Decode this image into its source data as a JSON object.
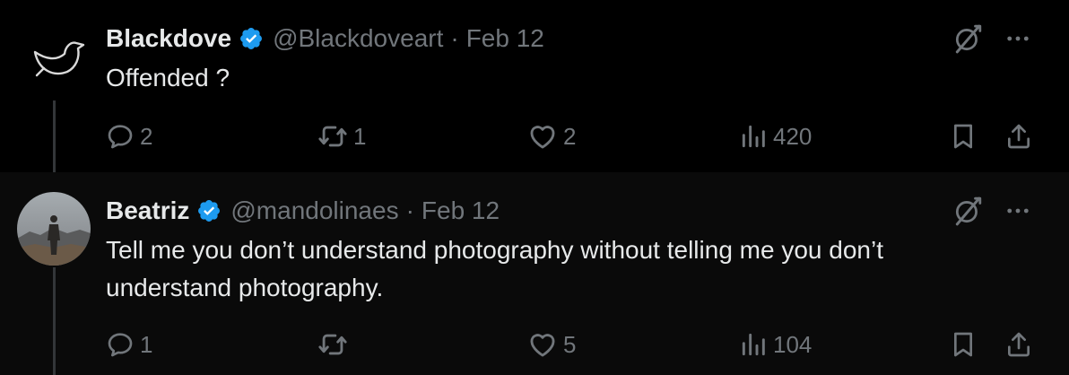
{
  "tweets": [
    {
      "name": "Blackdove",
      "handle": "@Blackdoveart",
      "separator": "·",
      "date": "Feb 12",
      "text": "Offended ?",
      "replies": "2",
      "retweets": "1",
      "likes": "2",
      "views": "420"
    },
    {
      "name": "Beatriz",
      "handle": "@mandolinaes",
      "separator": "·",
      "date": "Feb 12",
      "text": "Tell me you don’t understand photography without telling me you don’t understand photography.",
      "replies": "1",
      "retweets": "",
      "likes": "5",
      "views": "104"
    }
  ],
  "icons": {
    "verified": "verified-badge-icon",
    "grok": "grok-icon",
    "more": "more-icon",
    "reply": "reply-icon",
    "retweet": "retweet-icon",
    "like": "heart-icon",
    "views": "views-icon",
    "bookmark": "bookmark-icon",
    "share": "share-icon"
  },
  "colors": {
    "background": "#000000",
    "text": "#e7e9ea",
    "muted": "#71767b",
    "verified": "#1d9bf0"
  }
}
